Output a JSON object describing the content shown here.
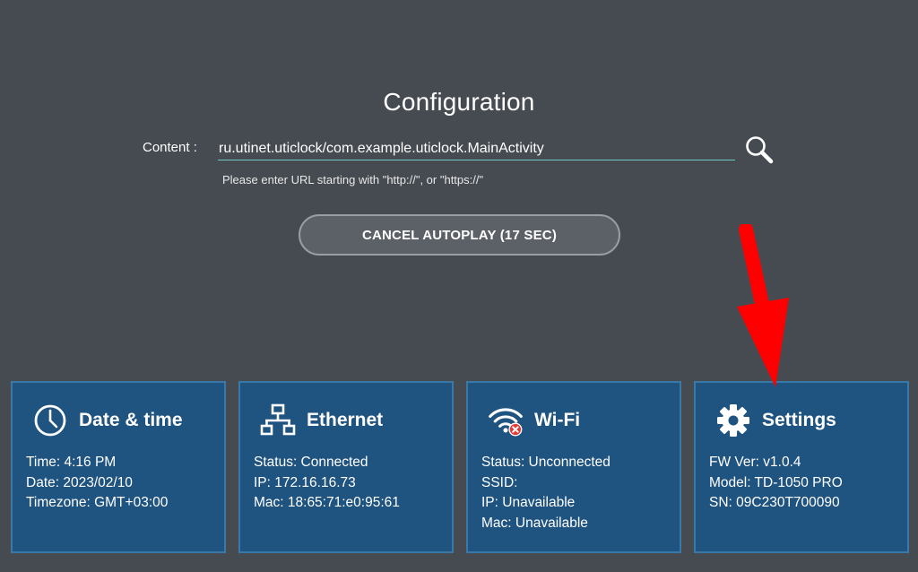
{
  "header": {
    "title": "Configuration"
  },
  "content": {
    "label": "Content :",
    "url_value": "ru.utinet.uticlock/com.example.uticlock.MainActivity",
    "hint": "Please enter URL starting with \"http://\", or \"https://\"",
    "search_icon": "search-icon"
  },
  "autoplay": {
    "cancel_label": "CANCEL AUTOPLAY (17 SEC)"
  },
  "cards": [
    {
      "icon": "clock-icon",
      "title": "Date & time",
      "lines": [
        "Time: 4:16 PM",
        "Date: 2023/02/10",
        "Timezone: GMT+03:00"
      ]
    },
    {
      "icon": "network-icon",
      "title": "Ethernet",
      "lines": [
        "Status: Connected",
        "IP: 172.16.16.73",
        "Mac: 18:65:71:e0:95:61"
      ]
    },
    {
      "icon": "wifi-disconnected-icon",
      "title": "Wi-Fi",
      "lines": [
        "Status: Unconnected",
        "SSID:",
        "IP: Unavailable",
        "Mac: Unavailable"
      ]
    },
    {
      "icon": "gear-icon",
      "title": "Settings",
      "lines": [
        "FW Ver: v1.0.4",
        "Model: TD-1050 PRO",
        "SN: 09C230T700090"
      ]
    }
  ],
  "colors": {
    "background": "#464b51",
    "card_background": "#1f5380",
    "card_border": "#3a78a8",
    "input_underline": "#6ec7c0",
    "annotation_arrow": "#ff0000",
    "wifi_error": "#e53935"
  }
}
